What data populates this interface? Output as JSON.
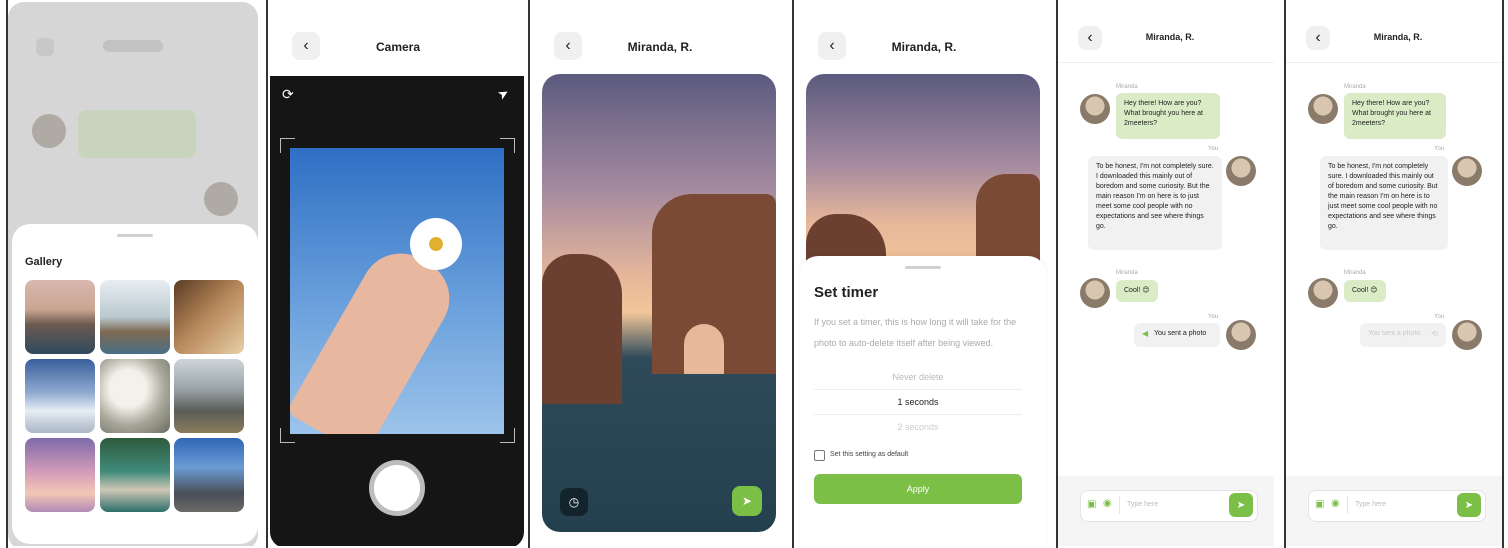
{
  "panel1": {
    "gallery_title": "Gallery"
  },
  "panel2": {
    "title": "Camera"
  },
  "panel3": {
    "title": "Miranda, R."
  },
  "panel4": {
    "title": "Miranda, R.",
    "sheet_title": "Set timer",
    "description": "If you set a timer, this is how long it will take for the photo to auto-delete itself after being viewed.",
    "options": [
      "Never delete",
      "1 seconds",
      "2 seconds"
    ],
    "selected_option": "1 seconds",
    "default_checkbox_label": "Set this setting as default",
    "apply_label": "Apply"
  },
  "panel5": {
    "title": "Miranda, R.",
    "msg1_sender": "Miranda",
    "msg1": "Hey there! How are you? What brought you here at 2meeters?",
    "msg2_sender": "You",
    "msg2": "To be honest, I'm not completely sure. I downloaded this mainly out of boredom and some curiosity. But the main reason I'm on here is to just meet some cool people with no expectations and see where things go.",
    "msg3_sender": "Miranda",
    "msg3": "Cool! 😊",
    "msg4_sender": "You",
    "msg4": "You sent a photo",
    "input_placeholder": "Type here"
  },
  "panel6": {
    "title": "Miranda, R.",
    "msg1_sender": "Miranda",
    "msg1": "Hey there! How are you? What brought you here at 2meeters?",
    "msg2_sender": "You",
    "msg2": "To be honest, I'm not completely sure. I downloaded this mainly out of boredom and some curiosity. But the main reason I'm on here is to just meet some cool people with no expectations and see where things go.",
    "msg3_sender": "Miranda",
    "msg3": "Cool! 😊",
    "msg4_sender": "You",
    "msg4": "You sent a photo",
    "input_placeholder": "Type here"
  },
  "colors": {
    "accent": "#7bbf47",
    "bubble_green": "#d9ecc6",
    "bubble_grey": "#f1f1f1",
    "camera_bg": "#151515"
  }
}
